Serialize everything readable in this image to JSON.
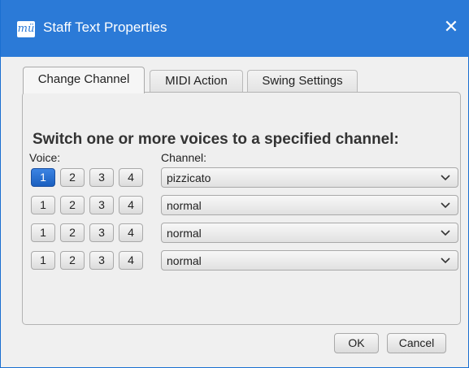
{
  "window": {
    "title": "Staff Text Properties",
    "icon_text": "mü",
    "close_glyph": "✕"
  },
  "tabs": [
    {
      "label": "Change Channel",
      "active": true
    },
    {
      "label": "MIDI Action",
      "active": false
    },
    {
      "label": "Swing Settings",
      "active": false
    }
  ],
  "panel": {
    "heading": "Switch one or more voices to a specified channel:",
    "voice_label": "Voice:",
    "channel_label": "Channel:",
    "voice_buttons": [
      "1",
      "2",
      "3",
      "4"
    ],
    "rows": [
      {
        "active_voice": "1",
        "channel": "pizzicato"
      },
      {
        "active_voice": null,
        "channel": "normal"
      },
      {
        "active_voice": null,
        "channel": "normal"
      },
      {
        "active_voice": null,
        "channel": "normal"
      }
    ]
  },
  "buttons": {
    "ok": "OK",
    "cancel": "Cancel"
  },
  "colors": {
    "titlebar": "#2b7ad7",
    "accent": "#1a5fbf",
    "background": "#f0f0f0"
  }
}
